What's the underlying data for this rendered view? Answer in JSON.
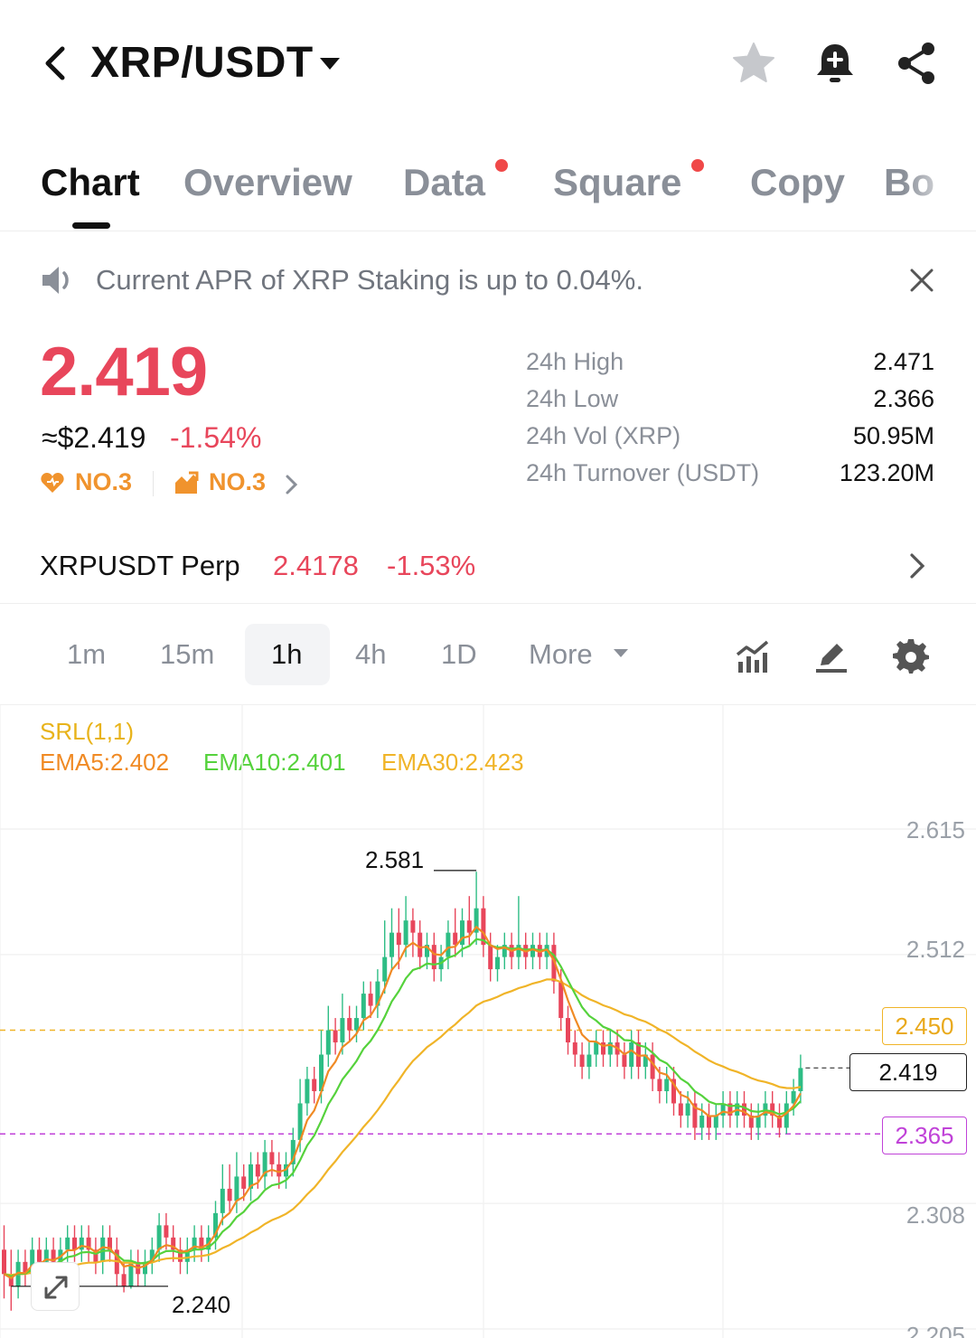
{
  "header": {
    "pair": "XRP/USDT",
    "icons": [
      "back-icon",
      "caret-down-icon",
      "star-icon",
      "bell-plus-icon",
      "share-icon"
    ]
  },
  "tabs": [
    {
      "label": "Chart",
      "active": true,
      "dot": false
    },
    {
      "label": "Overview",
      "active": false,
      "dot": false
    },
    {
      "label": "Data",
      "active": false,
      "dot": true
    },
    {
      "label": "Square",
      "active": false,
      "dot": true
    },
    {
      "label": "Copy",
      "active": false,
      "dot": false
    },
    {
      "label": "Bo",
      "active": false,
      "dot": false
    }
  ],
  "notice": {
    "text": "Current APR of XRP Staking is up to 0.04%."
  },
  "price": {
    "last": "2.419",
    "usd": "≈$2.419",
    "change": "-1.54%",
    "rank1": "NO.3",
    "rank2": "NO.3"
  },
  "stats": [
    {
      "label": "24h High",
      "value": "2.471"
    },
    {
      "label": "24h Low",
      "value": "2.366"
    },
    {
      "label": "24h Vol (XRP)",
      "value": "50.95M"
    },
    {
      "label": "24h Turnover (USDT)",
      "value": "123.20M"
    }
  ],
  "perp": {
    "name": "XRPUSDT Perp",
    "price": "2.4178",
    "change": "-1.53%"
  },
  "timeframes": {
    "items": [
      "1m",
      "15m",
      "1h",
      "4h",
      "1D"
    ],
    "active": "1h",
    "more": "More"
  },
  "indicators": {
    "srl": "SRL(1,1)",
    "ema5": "EMA5:2.402",
    "ema10": "EMA10:2.401",
    "ema30": "EMA30:2.423"
  },
  "colors": {
    "up": "#2ebd85",
    "down": "#e8465b",
    "ema5": "#f08a24",
    "ema10": "#55d23c",
    "ema30": "#f0b428",
    "srl": "#e8b31a",
    "support": "#c042d8"
  },
  "chart_data": {
    "type": "candlestick",
    "y_ticks": [
      "2.615",
      "2.512",
      "2.308",
      "2.205"
    ],
    "markers": {
      "high": "2.581",
      "low": "2.240"
    },
    "price_tags": {
      "srl_level": "2.450",
      "current": "2.419",
      "support": "2.365"
    },
    "ylim": [
      2.205,
      2.615
    ],
    "candles": [
      [
        2.27,
        2.25,
        2.29,
        2.23
      ],
      [
        2.25,
        2.24,
        2.27,
        2.22
      ],
      [
        2.24,
        2.26,
        2.27,
        2.23
      ],
      [
        2.26,
        2.25,
        2.27,
        2.24
      ],
      [
        2.25,
        2.27,
        2.28,
        2.24
      ],
      [
        2.27,
        2.26,
        2.28,
        2.25
      ],
      [
        2.26,
        2.27,
        2.28,
        2.25
      ],
      [
        2.27,
        2.26,
        2.28,
        2.25
      ],
      [
        2.26,
        2.27,
        2.28,
        2.25
      ],
      [
        2.27,
        2.28,
        2.29,
        2.26
      ],
      [
        2.28,
        2.27,
        2.29,
        2.26
      ],
      [
        2.27,
        2.28,
        2.29,
        2.26
      ],
      [
        2.28,
        2.27,
        2.29,
        2.26
      ],
      [
        2.27,
        2.26,
        2.28,
        2.25
      ],
      [
        2.26,
        2.28,
        2.29,
        2.25
      ],
      [
        2.28,
        2.27,
        2.29,
        2.26
      ],
      [
        2.27,
        2.25,
        2.28,
        2.24
      ],
      [
        2.25,
        2.24,
        2.26,
        2.235
      ],
      [
        2.24,
        2.26,
        2.27,
        2.238
      ],
      [
        2.26,
        2.25,
        2.27,
        2.24
      ],
      [
        2.25,
        2.26,
        2.27,
        2.24
      ],
      [
        2.26,
        2.27,
        2.28,
        2.25
      ],
      [
        2.27,
        2.29,
        2.3,
        2.26
      ],
      [
        2.29,
        2.28,
        2.3,
        2.27
      ],
      [
        2.28,
        2.27,
        2.29,
        2.26
      ],
      [
        2.27,
        2.26,
        2.28,
        2.25
      ],
      [
        2.26,
        2.27,
        2.28,
        2.25
      ],
      [
        2.27,
        2.28,
        2.29,
        2.26
      ],
      [
        2.28,
        2.27,
        2.29,
        2.26
      ],
      [
        2.27,
        2.28,
        2.29,
        2.26
      ],
      [
        2.28,
        2.3,
        2.31,
        2.27
      ],
      [
        2.3,
        2.32,
        2.34,
        2.29
      ],
      [
        2.32,
        2.31,
        2.34,
        2.3
      ],
      [
        2.31,
        2.33,
        2.35,
        2.3
      ],
      [
        2.33,
        2.32,
        2.34,
        2.31
      ],
      [
        2.32,
        2.34,
        2.35,
        2.31
      ],
      [
        2.34,
        2.33,
        2.35,
        2.32
      ],
      [
        2.33,
        2.35,
        2.36,
        2.32
      ],
      [
        2.35,
        2.34,
        2.36,
        2.33
      ],
      [
        2.34,
        2.33,
        2.35,
        2.32
      ],
      [
        2.33,
        2.34,
        2.35,
        2.32
      ],
      [
        2.34,
        2.36,
        2.37,
        2.33
      ],
      [
        2.36,
        2.39,
        2.41,
        2.35
      ],
      [
        2.39,
        2.41,
        2.42,
        2.38
      ],
      [
        2.41,
        2.4,
        2.42,
        2.39
      ],
      [
        2.4,
        2.43,
        2.45,
        2.39
      ],
      [
        2.43,
        2.45,
        2.47,
        2.42
      ],
      [
        2.45,
        2.44,
        2.46,
        2.43
      ],
      [
        2.44,
        2.46,
        2.48,
        2.43
      ],
      [
        2.46,
        2.45,
        2.47,
        2.44
      ],
      [
        2.45,
        2.46,
        2.47,
        2.44
      ],
      [
        2.46,
        2.48,
        2.49,
        2.45
      ],
      [
        2.48,
        2.47,
        2.49,
        2.46
      ],
      [
        2.47,
        2.49,
        2.5,
        2.46
      ],
      [
        2.49,
        2.51,
        2.54,
        2.48
      ],
      [
        2.51,
        2.53,
        2.55,
        2.5
      ],
      [
        2.53,
        2.52,
        2.55,
        2.5
      ],
      [
        2.52,
        2.54,
        2.56,
        2.51
      ],
      [
        2.54,
        2.53,
        2.55,
        2.51
      ],
      [
        2.53,
        2.51,
        2.54,
        2.5
      ],
      [
        2.51,
        2.52,
        2.53,
        2.5
      ],
      [
        2.52,
        2.5,
        2.53,
        2.49
      ],
      [
        2.5,
        2.51,
        2.52,
        2.49
      ],
      [
        2.51,
        2.53,
        2.54,
        2.5
      ],
      [
        2.53,
        2.52,
        2.55,
        2.51
      ],
      [
        2.52,
        2.54,
        2.55,
        2.51
      ],
      [
        2.54,
        2.53,
        2.56,
        2.52
      ],
      [
        2.53,
        2.55,
        2.58,
        2.52
      ],
      [
        2.55,
        2.52,
        2.56,
        2.51
      ],
      [
        2.52,
        2.5,
        2.53,
        2.49
      ],
      [
        2.5,
        2.51,
        2.52,
        2.49
      ],
      [
        2.51,
        2.52,
        2.53,
        2.5
      ],
      [
        2.52,
        2.51,
        2.53,
        2.5
      ],
      [
        2.51,
        2.52,
        2.56,
        2.5
      ],
      [
        2.52,
        2.51,
        2.53,
        2.5
      ],
      [
        2.51,
        2.52,
        2.53,
        2.5
      ],
      [
        2.52,
        2.51,
        2.53,
        2.5
      ],
      [
        2.51,
        2.52,
        2.53,
        2.5
      ],
      [
        2.52,
        2.49,
        2.53,
        2.48
      ],
      [
        2.49,
        2.46,
        2.5,
        2.45
      ],
      [
        2.46,
        2.44,
        2.47,
        2.43
      ],
      [
        2.44,
        2.43,
        2.45,
        2.42
      ],
      [
        2.43,
        2.42,
        2.44,
        2.41
      ],
      [
        2.42,
        2.43,
        2.44,
        2.41
      ],
      [
        2.43,
        2.44,
        2.45,
        2.42
      ],
      [
        2.44,
        2.43,
        2.45,
        2.42
      ],
      [
        2.43,
        2.44,
        2.45,
        2.42
      ],
      [
        2.44,
        2.43,
        2.45,
        2.42
      ],
      [
        2.43,
        2.42,
        2.44,
        2.41
      ],
      [
        2.42,
        2.44,
        2.45,
        2.41
      ],
      [
        2.44,
        2.42,
        2.45,
        2.41
      ],
      [
        2.42,
        2.43,
        2.44,
        2.41
      ],
      [
        2.43,
        2.41,
        2.44,
        2.4
      ],
      [
        2.41,
        2.4,
        2.42,
        2.39
      ],
      [
        2.4,
        2.41,
        2.42,
        2.39
      ],
      [
        2.41,
        2.39,
        2.42,
        2.38
      ],
      [
        2.39,
        2.38,
        2.4,
        2.37
      ],
      [
        2.38,
        2.39,
        2.4,
        2.37
      ],
      [
        2.39,
        2.37,
        2.4,
        2.36
      ],
      [
        2.37,
        2.38,
        2.39,
        2.36
      ],
      [
        2.38,
        2.37,
        2.39,
        2.36
      ],
      [
        2.37,
        2.38,
        2.39,
        2.36
      ],
      [
        2.38,
        2.39,
        2.4,
        2.37
      ],
      [
        2.39,
        2.38,
        2.4,
        2.37
      ],
      [
        2.38,
        2.39,
        2.4,
        2.37
      ],
      [
        2.39,
        2.38,
        2.4,
        2.37
      ],
      [
        2.38,
        2.37,
        2.39,
        2.36
      ],
      [
        2.37,
        2.38,
        2.39,
        2.36
      ],
      [
        2.38,
        2.39,
        2.4,
        2.37
      ],
      [
        2.39,
        2.38,
        2.4,
        2.37
      ],
      [
        2.38,
        2.37,
        2.39,
        2.362
      ],
      [
        2.37,
        2.39,
        2.4,
        2.365
      ],
      [
        2.39,
        2.4,
        2.41,
        2.38
      ],
      [
        2.4,
        2.419,
        2.43,
        2.39
      ]
    ]
  }
}
